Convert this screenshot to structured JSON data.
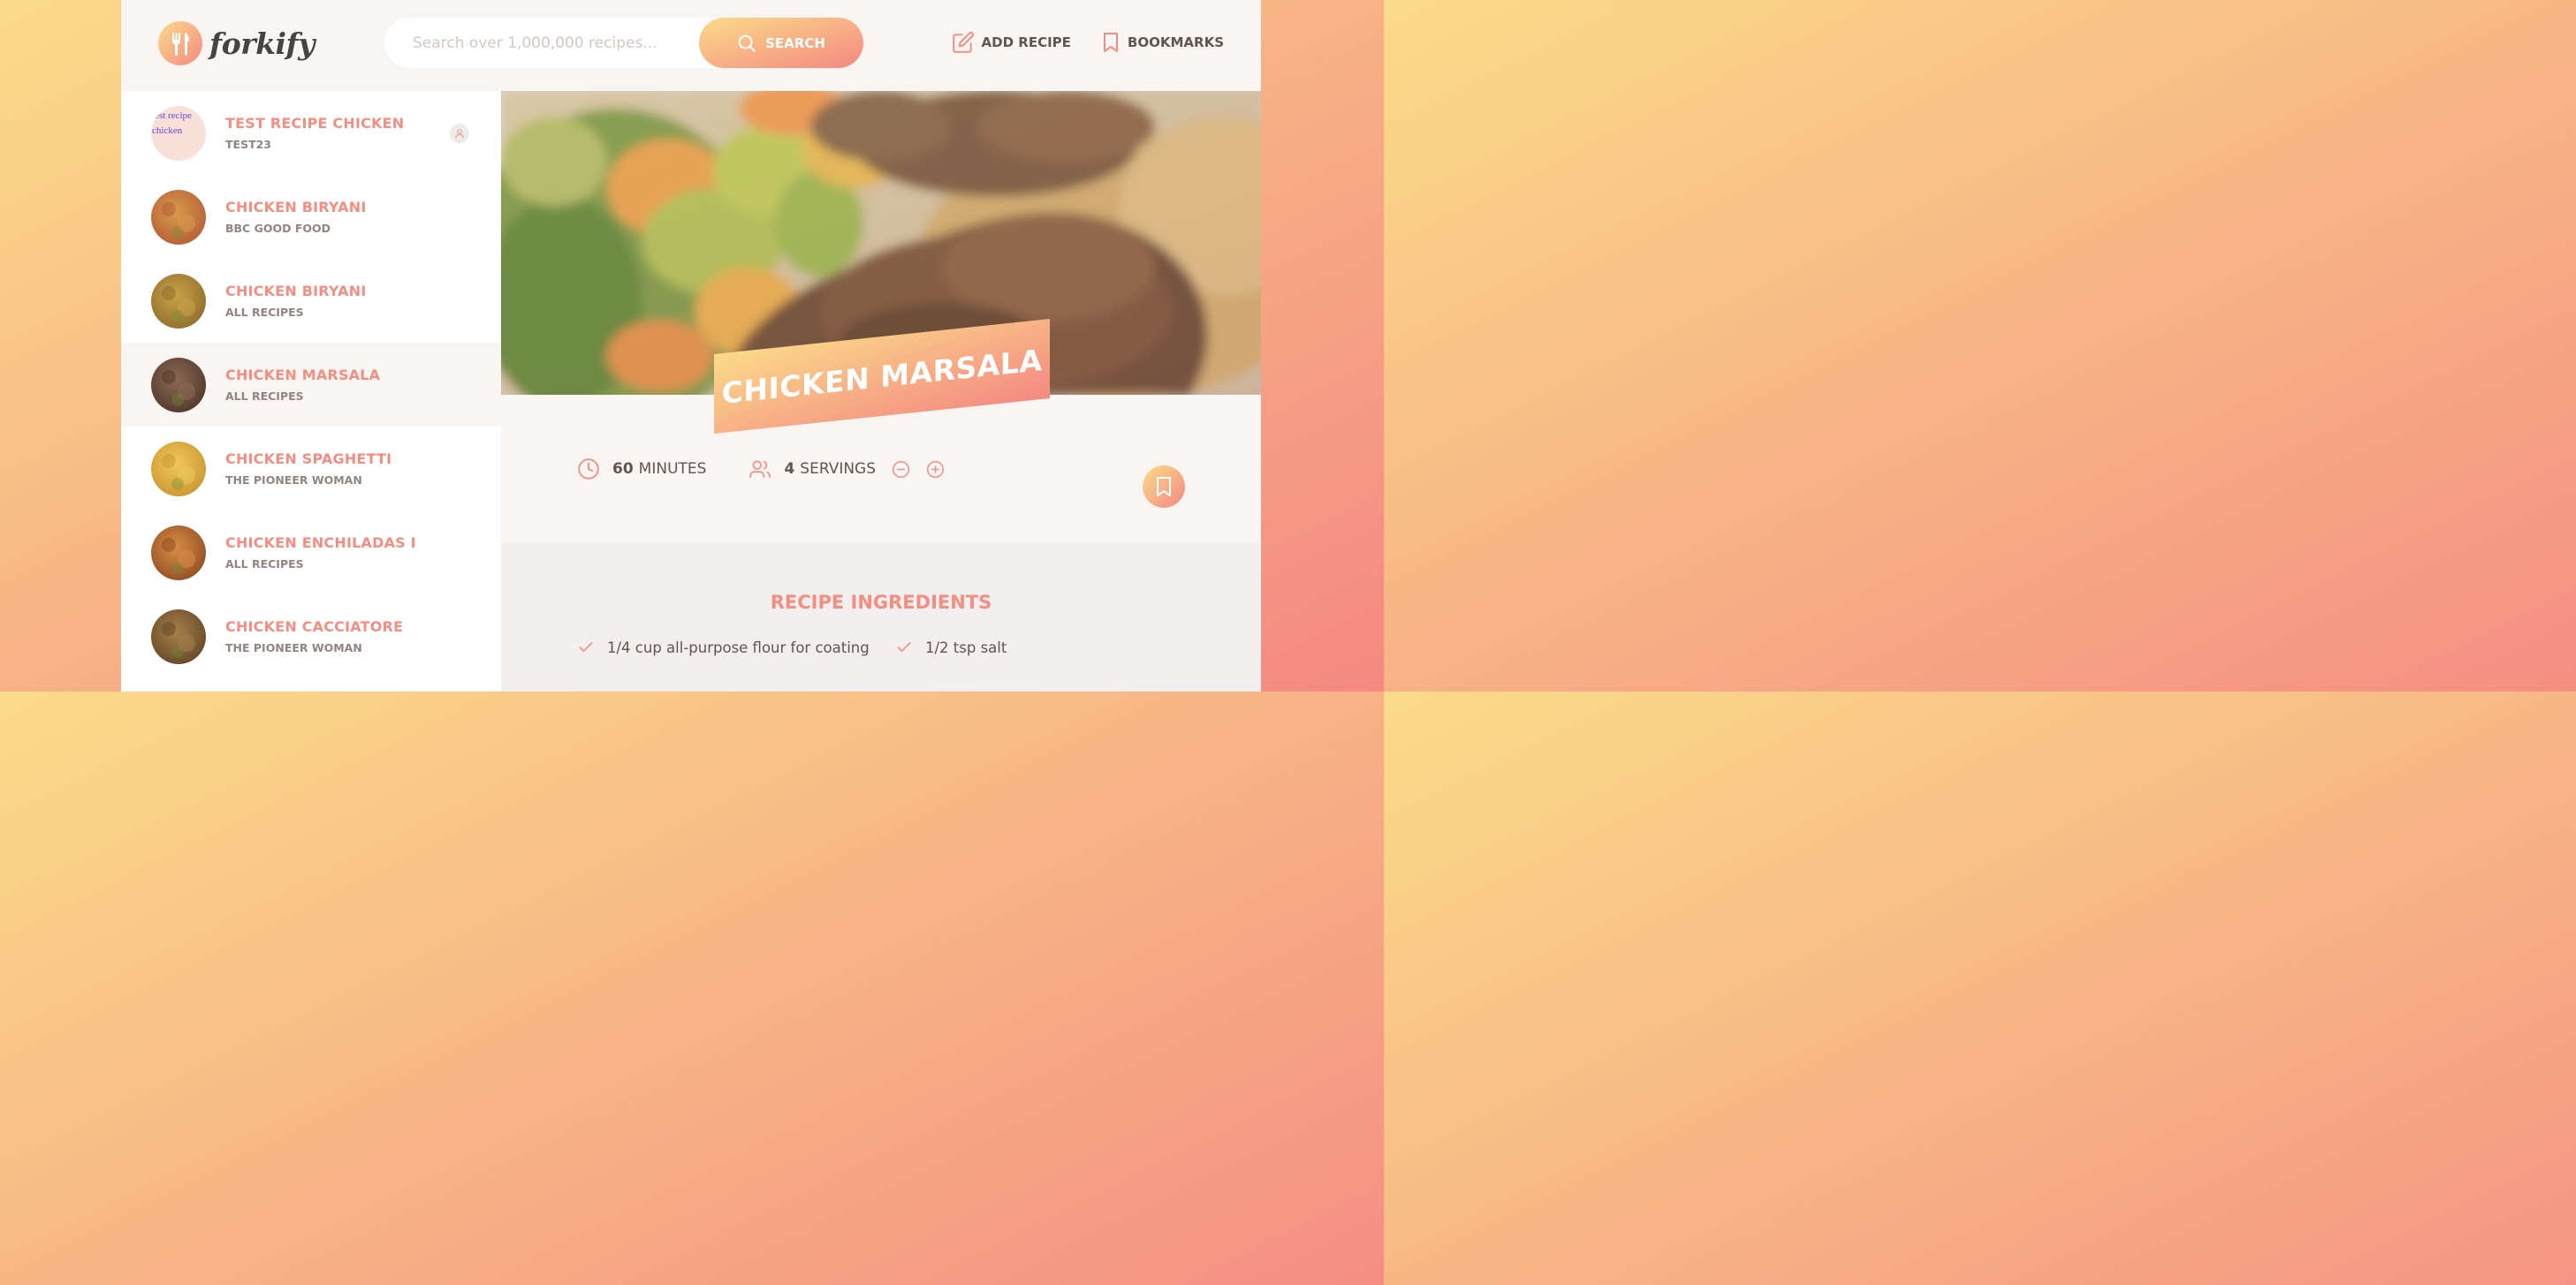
{
  "app": {
    "logo_text": "forkify"
  },
  "search": {
    "placeholder": "Search over 1,000,000 recipes...",
    "button_label": "SEARCH"
  },
  "nav": {
    "add_recipe": "ADD RECIPE",
    "bookmarks": "BOOKMARKS"
  },
  "results": [
    {
      "title": "TEST RECIPE CHICKEN",
      "publisher": "TEST23",
      "image_alt": "test recipe chicken",
      "user_generated": true,
      "active": false,
      "thumb": [
        "#f3d4c8",
        "#e8b9a8"
      ]
    },
    {
      "title": "CHICKEN BIRYANI",
      "publisher": "BBC GOOD FOOD",
      "user_generated": false,
      "active": false,
      "thumb": [
        "#d89a4b",
        "#b45a35"
      ]
    },
    {
      "title": "CHICKEN BIRYANI",
      "publisher": "ALL RECIPES",
      "user_generated": false,
      "active": false,
      "thumb": [
        "#c8a24a",
        "#8d6b2a"
      ]
    },
    {
      "title": "CHICKEN MARSALA",
      "publisher": "ALL RECIPES",
      "user_generated": false,
      "active": true,
      "thumb": [
        "#8a6a55",
        "#4e3527"
      ]
    },
    {
      "title": "CHICKEN SPAGHETTI",
      "publisher": "THE PIONEER WOMAN",
      "user_generated": false,
      "active": false,
      "thumb": [
        "#efc85a",
        "#c9932d"
      ]
    },
    {
      "title": "CHICKEN ENCHILADAS I",
      "publisher": "ALL RECIPES",
      "user_generated": false,
      "active": false,
      "thumb": [
        "#d98c45",
        "#8b4a20"
      ]
    },
    {
      "title": "CHICKEN CACCIATORE",
      "publisher": "THE PIONEER WOMAN",
      "user_generated": false,
      "active": false,
      "thumb": [
        "#a7804a",
        "#5f4426"
      ]
    }
  ],
  "recipe": {
    "title": "CHICKEN MARSALA",
    "cooking_time": "60",
    "cooking_time_unit": "MINUTES",
    "servings": "4",
    "servings_unit": "SERVINGS",
    "ingredients_heading": "RECIPE INGREDIENTS",
    "ingredients": [
      "1/4 cup all-purpose flour for coating",
      "1/2 tsp salt"
    ]
  },
  "colors": {
    "gradient_start": "#fbdb89",
    "gradient_end": "#f48982",
    "accent": "#f38e82",
    "text": "#615551"
  }
}
